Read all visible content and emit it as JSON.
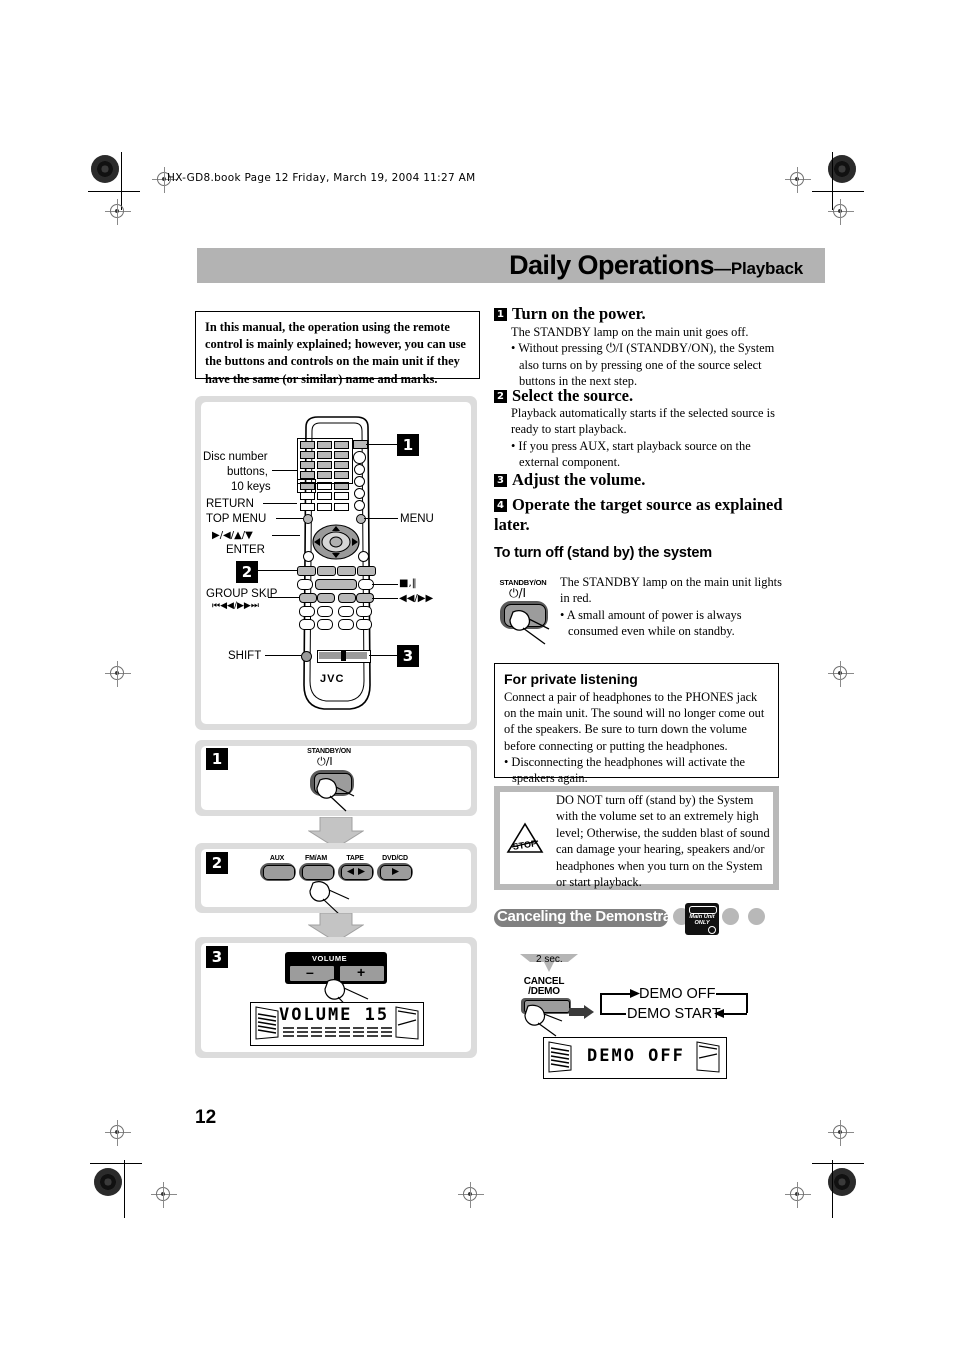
{
  "page": {
    "file_line": "HX-GD8.book  Page 12  Friday, March 19, 2004  11:27 AM",
    "number": "12",
    "header_main": "Daily Operations",
    "header_sub": "—Playback",
    "header_bg": "#b3b3b3"
  },
  "note_box": {
    "text": "In this manual, the operation using the remote control is mainly explained; however, you can use the buttons and controls on the main unit if they have the same (or similar) name and marks."
  },
  "steps": [
    {
      "num": "1",
      "title": "Turn on the power.",
      "body": "The STANDBY lamp on the main unit goes off.",
      "bullets": [
        "• Without pressing ⏻/I (STANDBY/ON), the System also turns on by pressing one of the source select buttons in the next step."
      ]
    },
    {
      "num": "2",
      "title": "Select the source.",
      "body": "Playback automatically starts if the selected source is ready to start playback.",
      "bullets": [
        "• If you press AUX, start playback source on the external component."
      ]
    },
    {
      "num": "3",
      "title": "Adjust the volume.",
      "body": "",
      "bullets": []
    },
    {
      "num": "4",
      "title": "Operate the target source as explained later.",
      "body": "",
      "bullets": []
    }
  ],
  "standby_section": {
    "heading": "To turn off (stand by) the system",
    "button_label": "STANDBY/ON",
    "button_symbol": "⏻/I",
    "text": "The STANDBY lamp on the main unit lights in red.",
    "bullet": "• A small amount of power is always consumed even while on standby."
  },
  "private_box": {
    "title": "For private listening",
    "text": "Connect a pair of headphones to the PHONES jack on the main unit. The sound will no longer come out of the speakers. Be sure to turn down the volume before connecting or putting the headphones.",
    "bullet": "• Disconnecting the headphones will activate the speakers again."
  },
  "caution_box": {
    "icon_label": "STOP",
    "text": "DO NOT turn off (stand by) the System with the volume set to an extremely high level; Otherwise, the sudden blast of sound can damage your hearing, speakers and/or headphones when you turn on the System or start playback."
  },
  "demo_section": {
    "title": "Canceling the Demonstration",
    "badge_line1": "Main Unit",
    "badge_line2": "ONLY",
    "hold_label": "2 sec.",
    "button_line1": "CANCEL",
    "button_line2": "/DEMO",
    "state_off": "DEMO OFF",
    "state_start": "DEMO START",
    "display_text": "DEMO  OFF"
  },
  "remote_panel": {
    "labels_left": [
      "Disc number",
      "buttons,",
      "10 keys",
      "RETURN",
      "TOP MENU",
      "▶/◀/▲/▼",
      "ENTER",
      "GROUP SKIP",
      "⏮◀◀/▶▶⏭",
      "SHIFT"
    ],
    "labels_right": [
      "MENU",
      "■,‖",
      "◀◀/▶▶"
    ],
    "callouts": [
      "1",
      "2",
      "3"
    ],
    "brand": "JVC"
  },
  "unit_panels": {
    "step1": {
      "num": "1",
      "button_label": "STANDBY/ON",
      "button_symbol": "⏻/I"
    },
    "step2": {
      "num": "2",
      "sources": [
        "AUX",
        "FM/AM",
        "TAPE",
        "DVD/CD"
      ]
    },
    "step3": {
      "num": "3",
      "volume_label": "VOLUME",
      "minus": "–",
      "plus": "+",
      "display_text": "VOLUME  15"
    }
  }
}
